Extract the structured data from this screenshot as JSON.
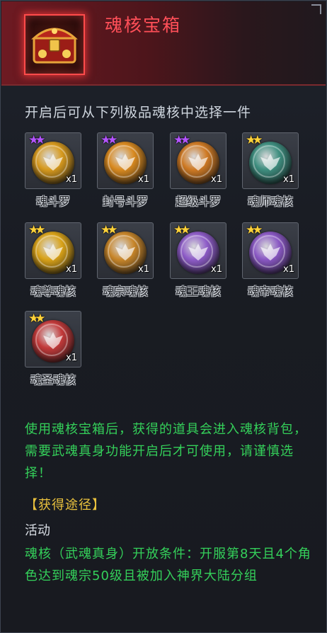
{
  "header": {
    "title": "魂核宝箱",
    "chest_icon": "treasure-chest"
  },
  "subtitle": "开启后可从下列极品魂核中选择一件",
  "items": [
    {
      "name": "魂斗罗",
      "count": "x1",
      "stars": 2,
      "star_color": "#b455ff",
      "orb_color": "#d79a1e"
    },
    {
      "name": "封号斗罗",
      "count": "x1",
      "stars": 2,
      "star_color": "#b455ff",
      "orb_color": "#d98a20"
    },
    {
      "name": "超级斗罗",
      "count": "x1",
      "stars": 2,
      "star_color": "#b455ff",
      "orb_color": "#cf7a24"
    },
    {
      "name": "魂师魂核",
      "count": "x1",
      "stars": 2,
      "star_color": "#ffd23a",
      "orb_color": "#3f8f80"
    },
    {
      "name": "魂尊魂核",
      "count": "x1",
      "stars": 2,
      "star_color": "#ffd23a",
      "orb_color": "#d9a218"
    },
    {
      "name": "魂宗魂核",
      "count": "x1",
      "stars": 2,
      "star_color": "#ffd23a",
      "orb_color": "#c8862a"
    },
    {
      "name": "魂王魂核",
      "count": "x1",
      "stars": 2,
      "star_color": "#ffd23a",
      "orb_color": "#8e5cc8"
    },
    {
      "name": "魂帝魂核",
      "count": "x1",
      "stars": 2,
      "star_color": "#ffd23a",
      "orb_color": "#8a58c4"
    },
    {
      "name": "魂圣魂核",
      "count": "x1",
      "stars": 2,
      "star_color": "#ffd23a",
      "orb_color": "#c33a3a"
    }
  ],
  "description": "使用魂核宝箱后，获得的道具会进入魂核背包，需要武魂真身功能开启后才可使用，请谨慎选择！",
  "source": {
    "heading": "【获得途径】",
    "activity": "活动",
    "condition": "魂核（武魂真身）开放条件：开服第8天且4个角色达到魂宗50级且被加入神界大陆分组"
  }
}
